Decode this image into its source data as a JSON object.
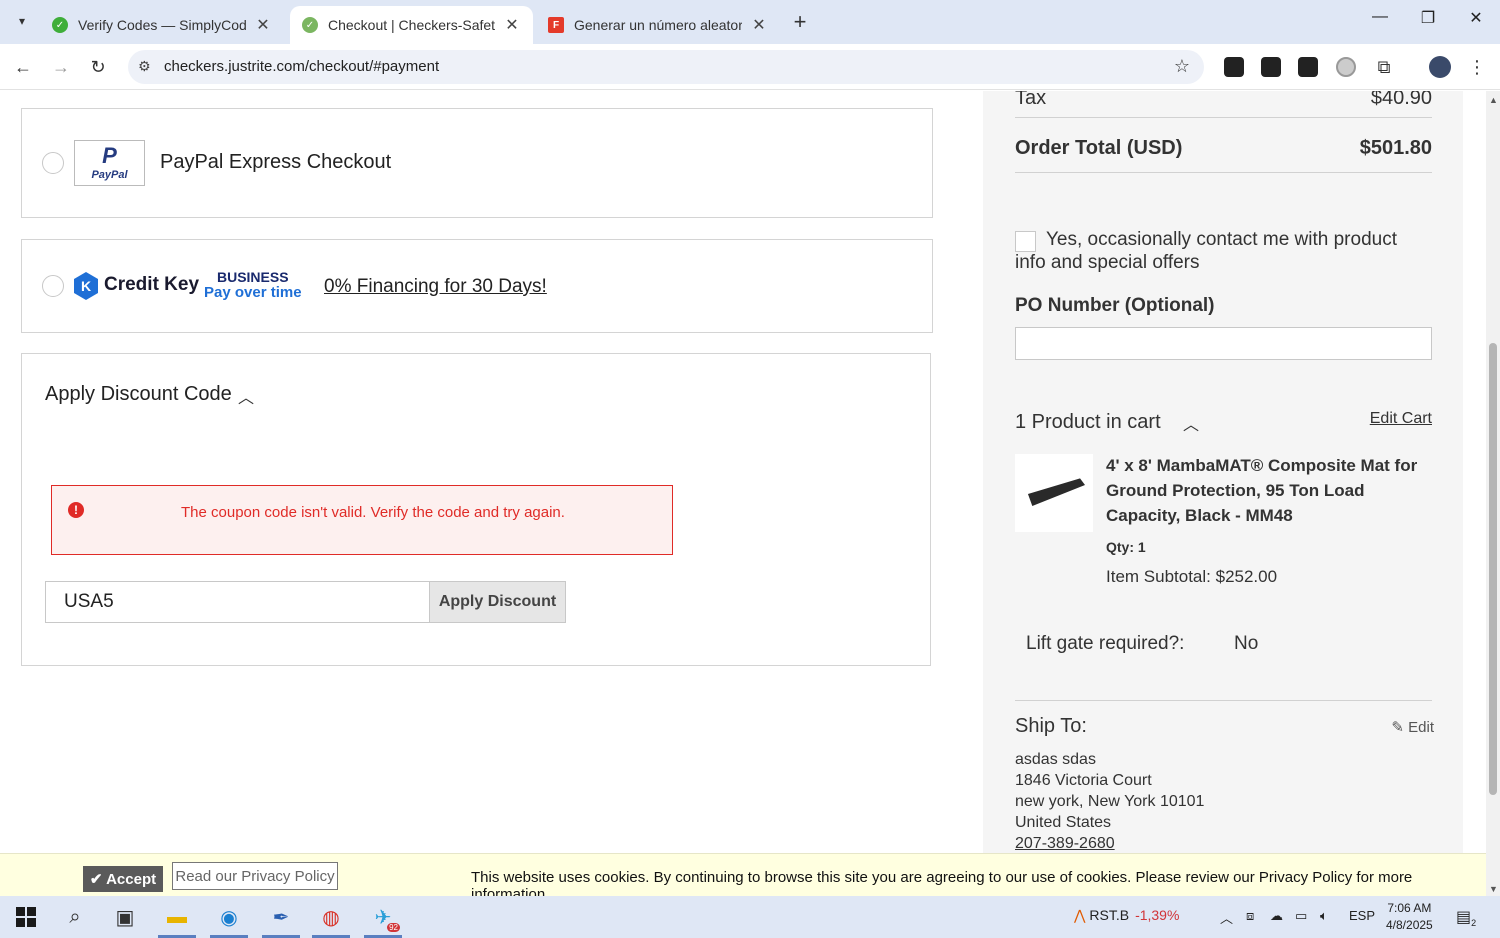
{
  "browser": {
    "tabs": [
      {
        "title": "Verify Codes — SimplyCodes",
        "active": false,
        "color": "#3fae3a"
      },
      {
        "title": "Checkout | Checkers-Safety",
        "active": true,
        "color": "#7bb661"
      },
      {
        "title": "Generar un número aleatorio - (",
        "active": false,
        "color": "#e43a2a"
      }
    ],
    "url": "checkers.justrite.com/checkout/#payment"
  },
  "payment": {
    "paypal_label": "PayPal Express Checkout",
    "paypal_logo_text": "PayPal",
    "creditkey_name": "Credit Key",
    "creditkey_business": "BUSINESS",
    "creditkey_payover": "Pay over time",
    "creditkey_financing": "0% Financing for 30 Days!"
  },
  "discount": {
    "title": "Apply Discount Code",
    "error": "The coupon code isn't valid. Verify the code and try again.",
    "code_value": "USA5",
    "apply_label": "Apply Discount"
  },
  "summary": {
    "tax_label": "Tax",
    "tax_value": "$40.90",
    "total_label": "Order Total (USD)",
    "total_value": "$501.80",
    "contact_opt": "Yes, occasionally contact me with product info and special offers",
    "po_label": "PO Number (Optional)",
    "cart_count": "1 Product in cart",
    "edit_cart": "Edit Cart",
    "product_name": "4' x 8' MambaMAT® Composite Mat for Ground Protection, 95 Ton Load Capacity, Black - MM48",
    "qty": "Qty: 1",
    "item_subtotal": "Item Subtotal: $252.00",
    "lift_label": "Lift gate required?:",
    "lift_value": "No",
    "ship_to_label": "Ship To:",
    "ship_edit": "Edit",
    "address": {
      "name": "asdas sdas",
      "street": "1846 Victoria Court",
      "city": "new york, New York 10101",
      "country": "United States",
      "phone": "207-389-2680"
    }
  },
  "cookie": {
    "accept": "Accept",
    "privacy": "Read our Privacy Policy",
    "text": "This website uses cookies. By continuing to browse this site you are agreeing to our use of cookies. Please review our Privacy Policy for more information."
  },
  "taskbar": {
    "stock_symbol": "RST.B",
    "stock_change": "-1,39%",
    "lang": "ESP",
    "time": "7:06 AM",
    "date": "4/8/2025",
    "notif_count": "2",
    "telegram_badge": "92"
  }
}
